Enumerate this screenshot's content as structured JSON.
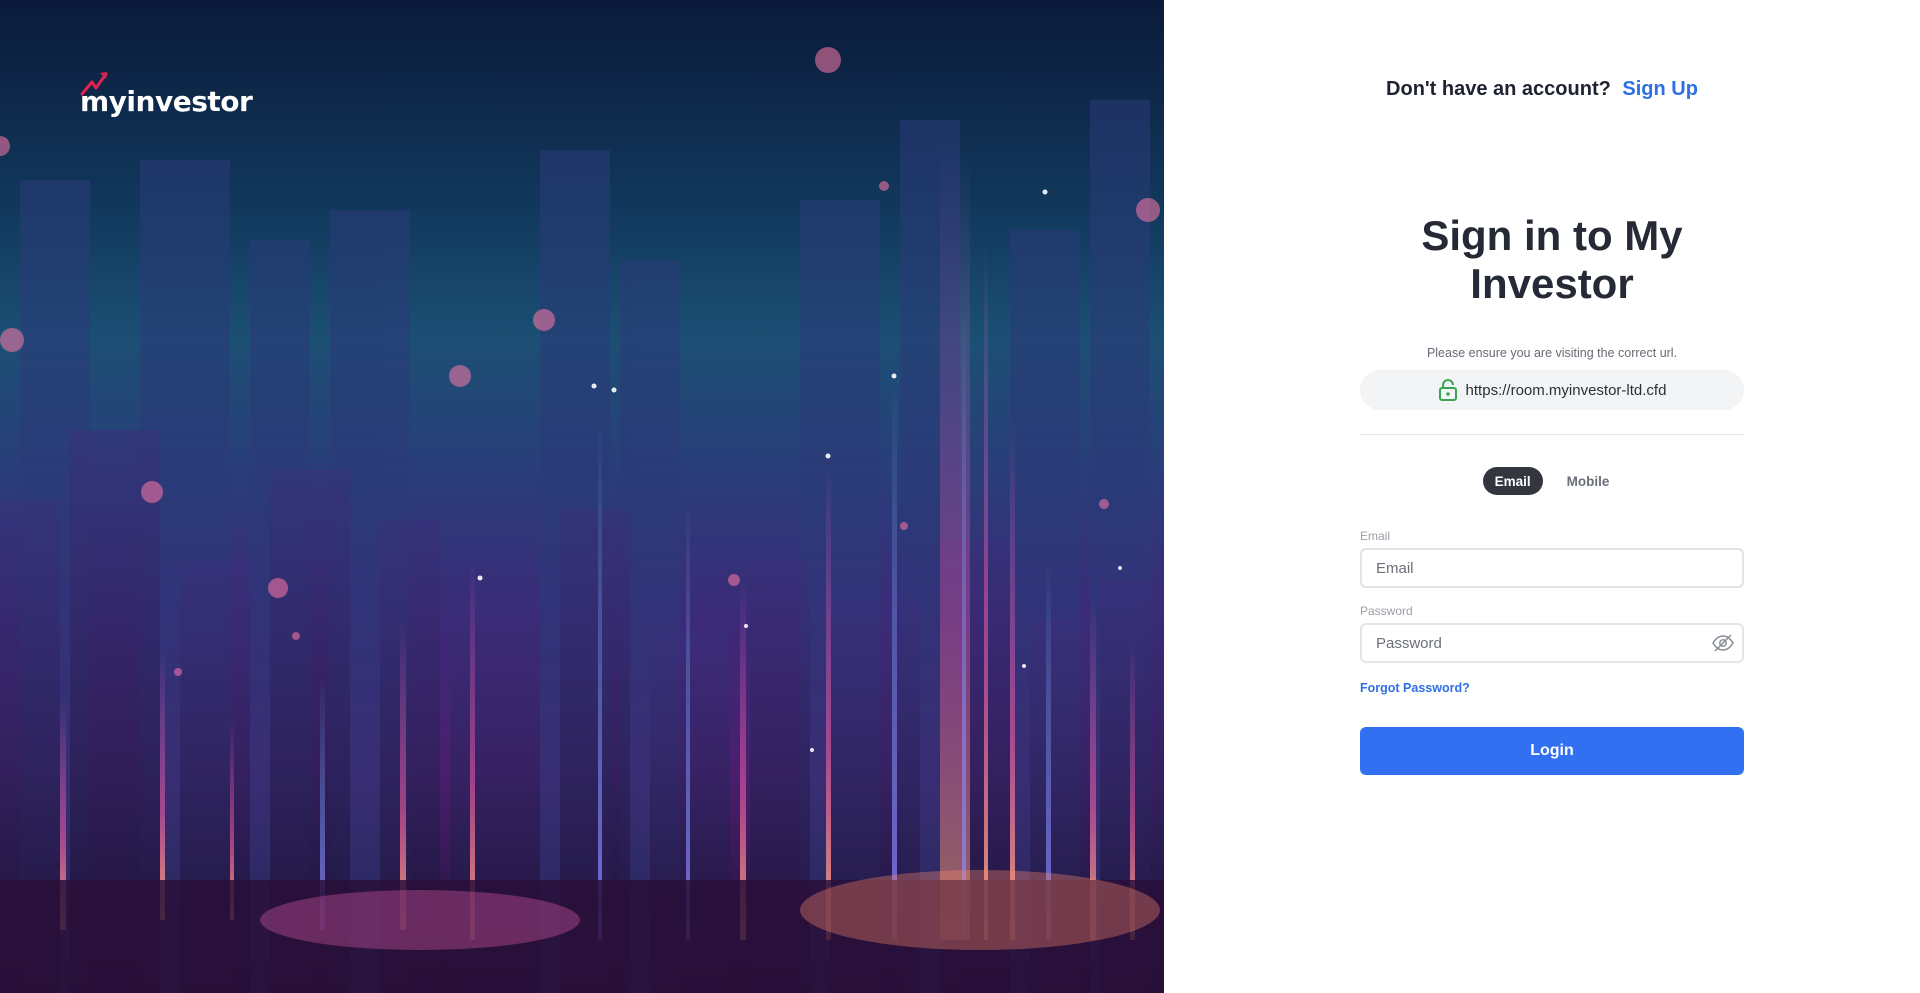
{
  "brand": {
    "logo_text": "myinvestor",
    "accent_color": "#e0244f"
  },
  "header": {
    "prompt": "Don't have an account?",
    "signup_label": "Sign Up"
  },
  "form": {
    "title": "Sign in to My Investor",
    "notice": "Please ensure you are visiting the correct url.",
    "url": "https://room.myinvestor-ltd.cfd",
    "tabs": [
      {
        "label": "Email",
        "active": true
      },
      {
        "label": "Mobile",
        "active": false
      }
    ],
    "email_label": "Email",
    "email_placeholder": "Email",
    "password_label": "Password",
    "password_placeholder": "Password",
    "forgot_label": "Forgot Password?",
    "login_label": "Login"
  },
  "icons": {
    "lock": "lock-icon",
    "eye": "eye-off-icon"
  },
  "colors": {
    "primary": "#3170f0",
    "link": "#2f6fe6",
    "lock_green": "#3aa655"
  }
}
